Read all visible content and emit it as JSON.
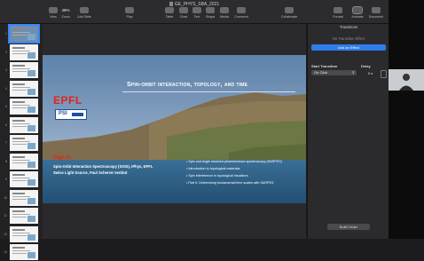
{
  "window": {
    "title": "GE_PHYS_SBA_2021"
  },
  "toolbar": {
    "view": "View",
    "zoom_value": "48%",
    "zoom": "Zoom",
    "add_slide": "Add Slide",
    "play": "Play",
    "table": "Table",
    "chart": "Chart",
    "text": "Text",
    "shape": "Shape",
    "media": "Media",
    "comment": "Comment",
    "collaborate": "Collaborate",
    "format": "Format",
    "animate": "Animate",
    "document": "Document"
  },
  "navigator": {
    "slides": [
      "1",
      "2",
      "3",
      "4",
      "5",
      "6",
      "7",
      "8",
      "9",
      "10",
      "11",
      "12",
      "13"
    ]
  },
  "slide": {
    "title": "Spin-orbit interaction, topology, and time",
    "logo_epfl": "EPFL",
    "logo_psi": "PSI",
    "sign_in": "Sign In",
    "institution_lines": [
      "Spin-Orbit Interaction Spectroscopy (SOIS), IPhys, EPFL",
      "Swiss Light Source, Paul Scherrer Institut"
    ],
    "bullets": [
      "• Spin and angle resolved photoemission spectroscopy (SARPES)",
      "• Introduction to topological materials",
      "• Spin interference in topological insulators",
      "• Part II: Determining fundamental time scales with SARPES"
    ]
  },
  "inspector": {
    "tab": "Transitions",
    "no_transition": "No Transition Effect",
    "add_effect": "Add an Effect",
    "start_transition_label": "Start Transition",
    "start_transition_value": "On Click",
    "delay_label": "Delay",
    "delay_value": "0 s",
    "build_order": "Build Order"
  },
  "colors": {
    "accent": "#2f7de8",
    "epfl_red": "#e2231a"
  }
}
